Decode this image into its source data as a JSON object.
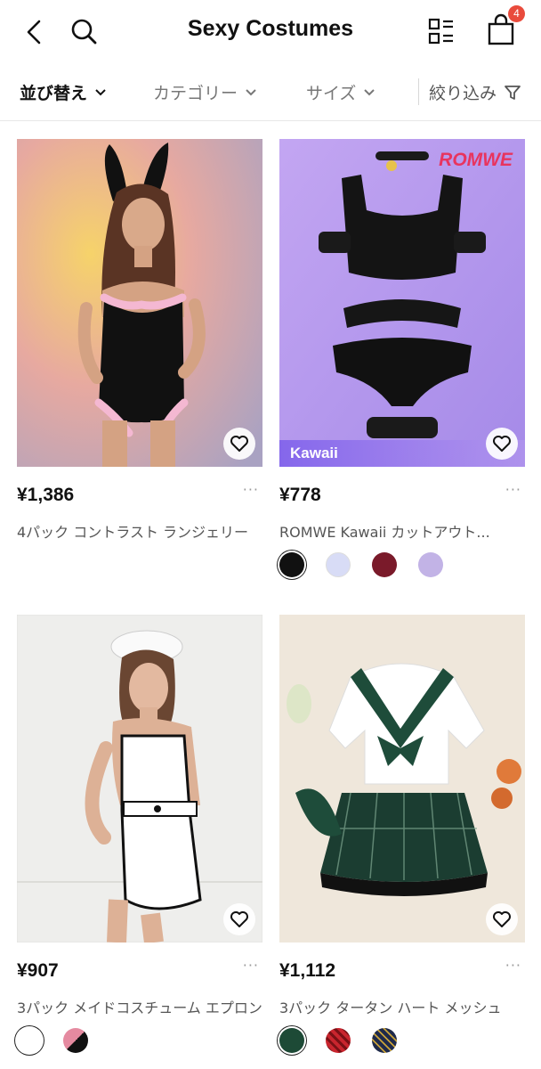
{
  "header": {
    "title": "Sexy Costumes",
    "cart_count": "4"
  },
  "filters": {
    "sort": "並び替え",
    "category": "カテゴリー",
    "size": "サイズ",
    "refine": "絞り込み"
  },
  "products": [
    {
      "price": "¥1,386",
      "name": "4パック コントラスト ランジェリー",
      "more": "···",
      "swatches": []
    },
    {
      "price": "¥778",
      "name": "ROMWE Kawaii カットアウト...",
      "more": "···",
      "brand": "ROMWE",
      "tag": "Kawaii",
      "swatches": [
        "#111111",
        "#d8dcf6",
        "#7a1a2a",
        "#c2b3e6"
      ]
    },
    {
      "price": "¥907",
      "name": "3パック メイドコスチューム エプロン",
      "more": "···",
      "swatches": [
        "#ffffff",
        "#e58aa0"
      ]
    },
    {
      "price": "¥1,112",
      "name": "3パック タータン ハート メッシュ",
      "more": "···",
      "swatches": [
        "#1d4a36",
        "#c9252e",
        "#1f2a4a"
      ]
    }
  ],
  "colors": {
    "badge": "#e94b3c",
    "romwe": "#e8345e",
    "kawaii": "#8264eb"
  },
  "icons": [
    "back-arrow-icon",
    "search-icon",
    "grid-icon",
    "shopping-bag-icon",
    "chevron-down-icon",
    "filter-funnel-icon",
    "heart-icon"
  ]
}
